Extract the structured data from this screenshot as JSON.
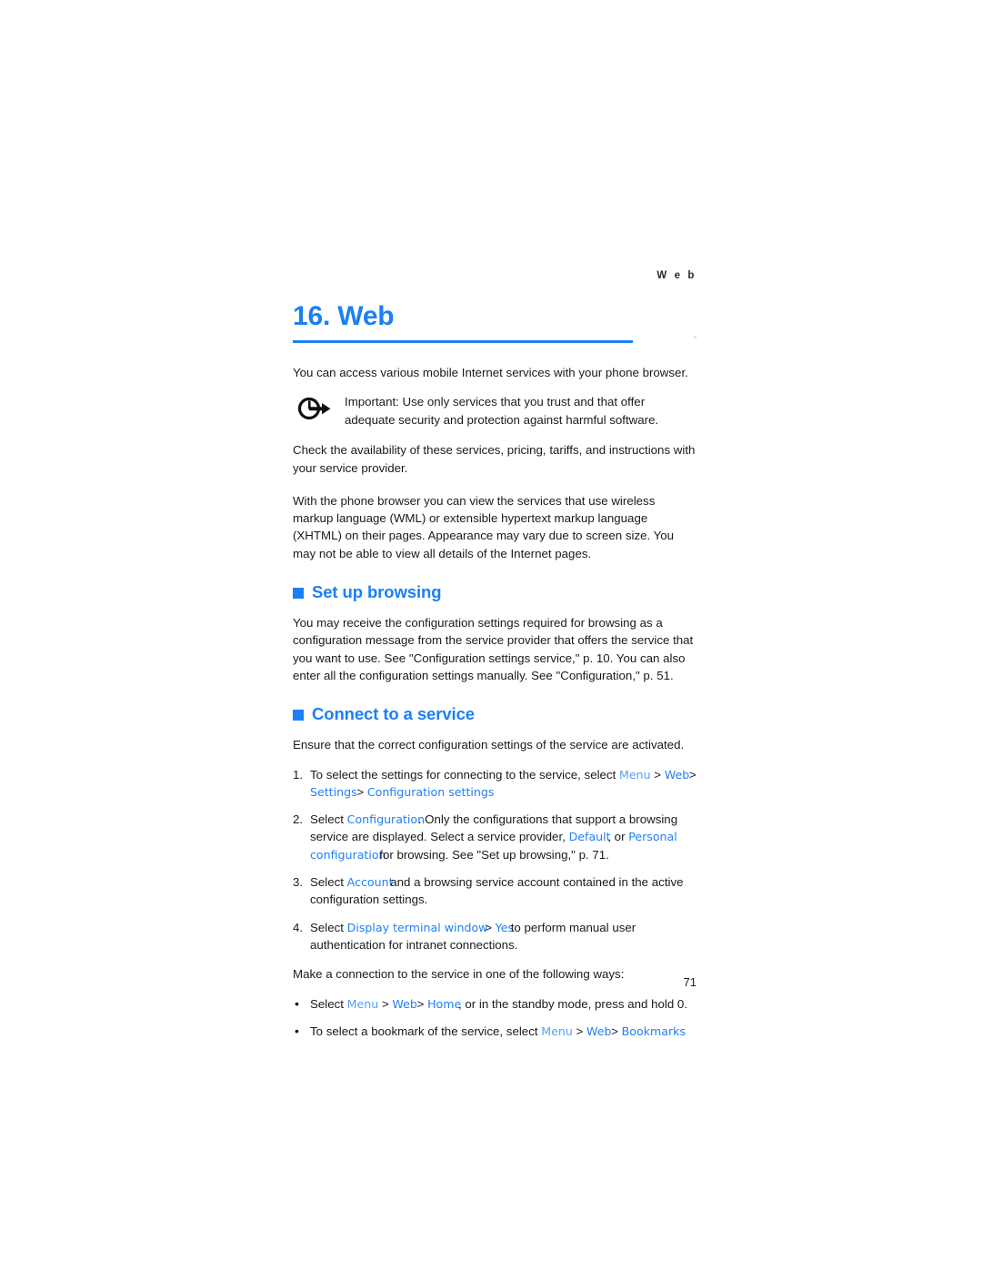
{
  "header": {
    "running_head": "W e b",
    "page_number": "71"
  },
  "chapter": {
    "title": "16. Web"
  },
  "intro": {
    "paragraph": "You can access various mobile Internet services with your phone browser."
  },
  "note": {
    "icon": "circle-arrow-icon",
    "text": "Important: Use only services that you trust and that offer adequate security and protection against harmful software."
  },
  "availability": {
    "paragraph": "Check the availability of these services, pricing, tariffs, and instructions with your service provider."
  },
  "markup": {
    "paragraph": "With the phone browser you can view the services that use wireless markup language (WML) or extensible hypertext markup language (XHTML) on their pages. Appearance may vary due to screen size. You may not be able to view all details of the Internet pages."
  },
  "set_up_browsing": {
    "heading": "Set up browsing",
    "paragraph": "You may receive the configuration settings required for browsing as a configuration message from the service provider that offers the service that you want to use. See \"Configuration settings service,\" p. 10. You can also enter all the configuration settings manually. See \"Configuration,\" p. 51."
  },
  "connect_to_service": {
    "heading": "Connect to a service",
    "intro": "Ensure that the correct configuration settings of the service are activated.",
    "steps": [
      {
        "marker": "1.",
        "lead": "To select the settings for connecting to the service, select",
        "ui_menu": "Menu",
        "sep1": ">",
        "ui_web": "Web",
        "sep2": ">",
        "ui_settings": "Settings",
        "sep3": ">",
        "ui_config_settings": "Configuration settings",
        "tail": "."
      },
      {
        "marker": "2.",
        "lead": "Select",
        "ui_configuration": "Configuration",
        "mid1": ". Only the configurations that support a browsing service are displayed. Select a service provider,",
        "ui_default": "Default",
        "mid2": ", or",
        "ui_personal": "Personal configuration",
        "tail": "for browsing. See \"Set up browsing,\" p. 71."
      },
      {
        "marker": "3.",
        "lead": "Select",
        "ui_account": "Account",
        "tail": "and a browsing service account contained in the active configuration settings."
      },
      {
        "marker": "4.",
        "lead": "Select",
        "ui_display_terminal": "Display terminal window",
        "sep1": ">",
        "ui_yes": "Yes",
        "tail": "to perform manual user authentication for intranet connections."
      }
    ],
    "ways_intro": "Make a connection to the service in one of the following ways:",
    "ways": [
      {
        "marker": "•",
        "lead": "Select",
        "ui_menu": "Menu",
        "sep1": ">",
        "ui_web": "Web",
        "sep2": ">",
        "ui_home": "Home",
        "tail": ", or in the standby mode, press and hold 0."
      },
      {
        "marker": "•",
        "lead": "To select a bookmark of the service, select",
        "ui_menu": "Menu",
        "sep1": ">",
        "ui_web": "Web",
        "sep2": ">",
        "ui_bookmarks": "Bookmarks",
        "tail": "."
      }
    ]
  },
  "colors": {
    "accent_blue": "#1b7ff5",
    "ui_term_blue": "#2180f7",
    "ui_term_light_blue": "#5a9ef5",
    "body_text": "#1a1a1a"
  }
}
